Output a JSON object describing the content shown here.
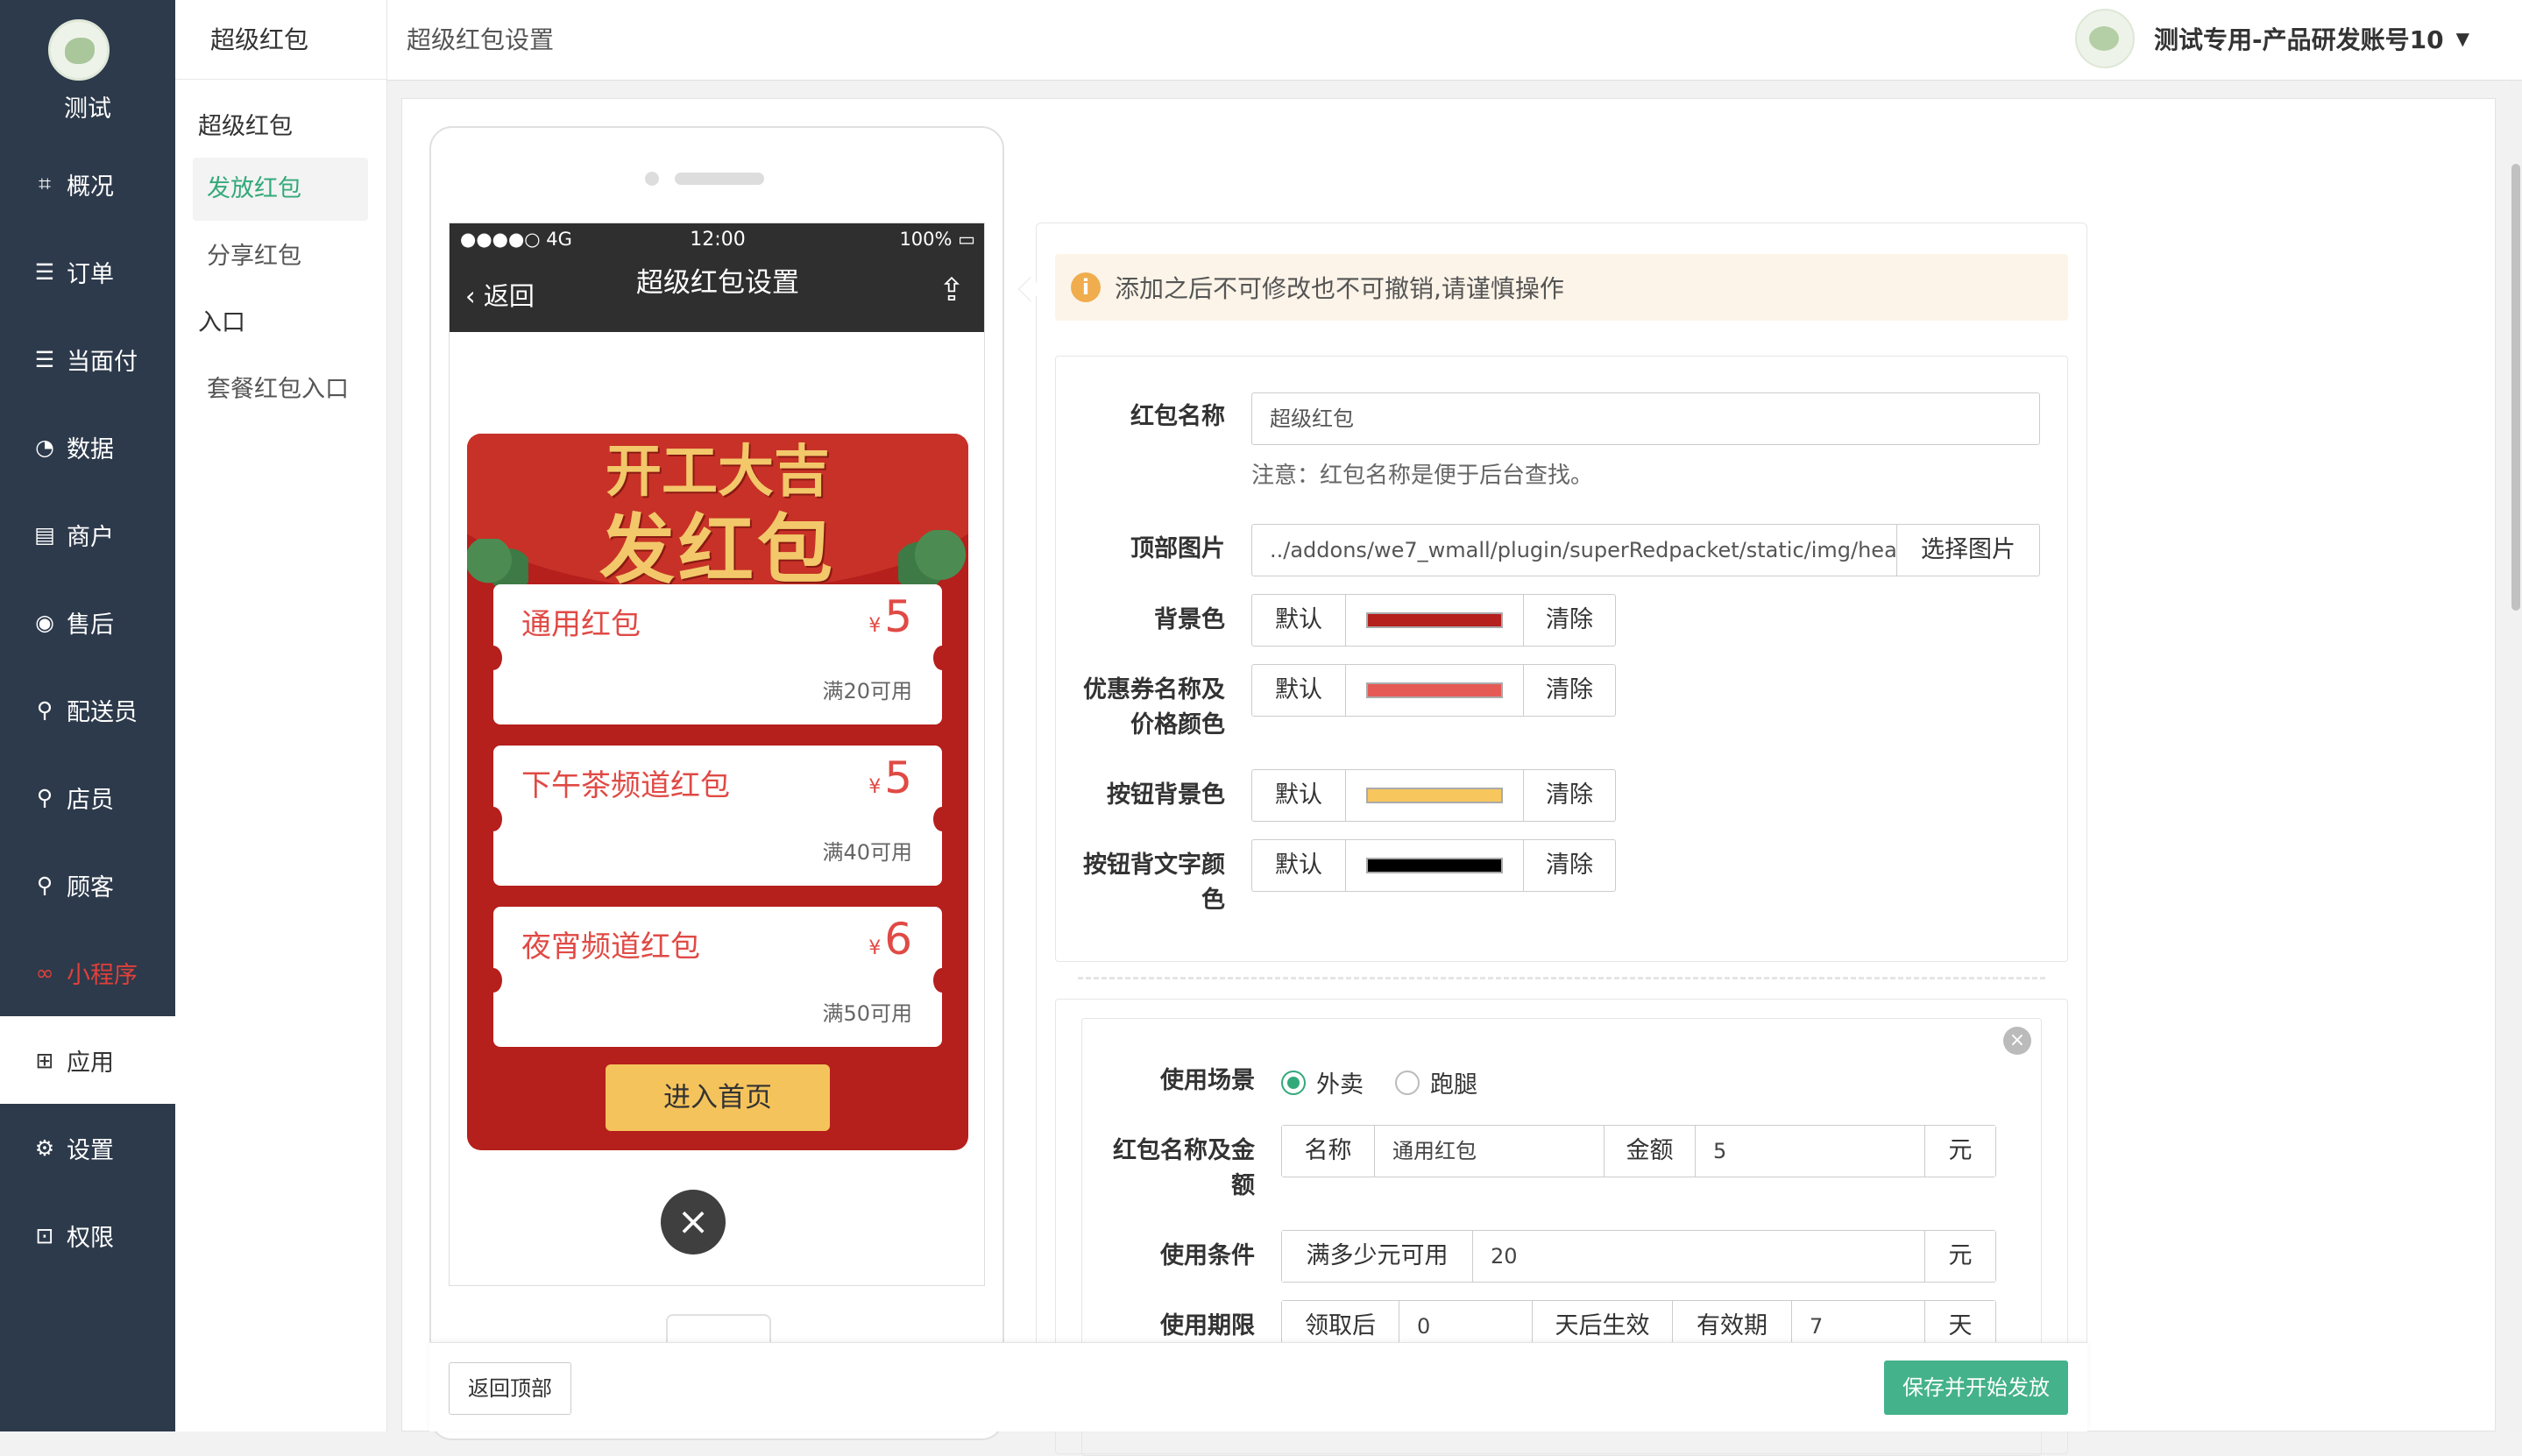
{
  "sidebar": {
    "shop_name": "测试",
    "items": [
      {
        "label": "概况",
        "icon": "⌗"
      },
      {
        "label": "订单",
        "icon": "☰"
      },
      {
        "label": "当面付",
        "icon": "☰"
      },
      {
        "label": "数据",
        "icon": "◔"
      },
      {
        "label": "商户",
        "icon": "▤"
      },
      {
        "label": "售后",
        "icon": "◉"
      },
      {
        "label": "配送员",
        "icon": "⚲"
      },
      {
        "label": "店员",
        "icon": "⚲"
      },
      {
        "label": "顾客",
        "icon": "⚲"
      },
      {
        "label": "小程序",
        "icon": "∞"
      },
      {
        "label": "应用",
        "icon": "⊞"
      },
      {
        "label": "设置",
        "icon": "⚙"
      },
      {
        "label": "权限",
        "icon": "⊡"
      }
    ]
  },
  "subnav": {
    "title": "超级红包",
    "group1": "超级红包",
    "items1": [
      "发放红包",
      "分享红包"
    ],
    "group2": "入口",
    "items2": [
      "套餐红包入口"
    ]
  },
  "topbar": {
    "breadcrumb": "超级红包设置",
    "account": "测试专用-产品研发账号10"
  },
  "phone": {
    "status_signal": "●●●●○ 4G",
    "status_time": "12:00",
    "status_battery": "100% ▭",
    "back": "返回",
    "title": "超级红包设置",
    "header_line1": "开工大吉",
    "header_line2": "发红包",
    "coupons": [
      {
        "name": "通用红包",
        "currency": "¥",
        "amount": "5",
        "condition": "满20可用"
      },
      {
        "name": "下午茶频道红包",
        "currency": "¥",
        "amount": "5",
        "condition": "满40可用"
      },
      {
        "name": "夜宵频道红包",
        "currency": "¥",
        "amount": "6",
        "condition": "满50可用"
      }
    ],
    "enter_button": "进入首页",
    "close": "×"
  },
  "form": {
    "warning": "添加之后不可修改也不可撤销,请谨慎操作",
    "name_label": "红包名称",
    "name_value": "超级红包",
    "name_hint": "注意：红包名称是便于后台查找。",
    "header_img_label": "顶部图片",
    "header_img_value": "../addons/we7_wmall/plugin/superRedpacket/static/img/header.png",
    "select_image": "选择图片",
    "default_label": "默认",
    "clear_label": "清除",
    "colors": [
      {
        "label_line1": "背景色",
        "label_line2": "",
        "color": "#b51f1c"
      },
      {
        "label_line1": "优惠券名称及",
        "label_line2": "价格颜色",
        "color": "#e55a55"
      },
      {
        "label_line1": "按钮背景色",
        "label_line2": "",
        "color": "#f7c65c"
      },
      {
        "label_line1": "按钮背文字颜",
        "label_line2": "色",
        "color": "#000000"
      }
    ],
    "scene_label": "使用场景",
    "scene_options": [
      "外卖",
      "跑腿"
    ],
    "scene_selected": "外卖",
    "name_amount_label_line1": "红包名称及金",
    "name_amount_label_line2": "额",
    "name_addon": "名称",
    "coupon_name_value": "通用红包",
    "amount_addon": "金额",
    "amount_value": "5",
    "yuan": "元",
    "condition_label": "使用条件",
    "condition_addon": "满多少元可用",
    "condition_value": "20",
    "period_label": "使用期限",
    "period_after": "领取后",
    "period_after_value": "0",
    "period_effective": "天后生效",
    "period_valid": "有效期",
    "period_valid_value": "7",
    "day": "天"
  },
  "footer": {
    "back_top": "返回顶部",
    "save": "保存并开始发放"
  },
  "colors": {
    "sidebar_bg": "#2d3a4b",
    "accent_green": "#44b28a",
    "packet_red": "#b51f1c"
  }
}
